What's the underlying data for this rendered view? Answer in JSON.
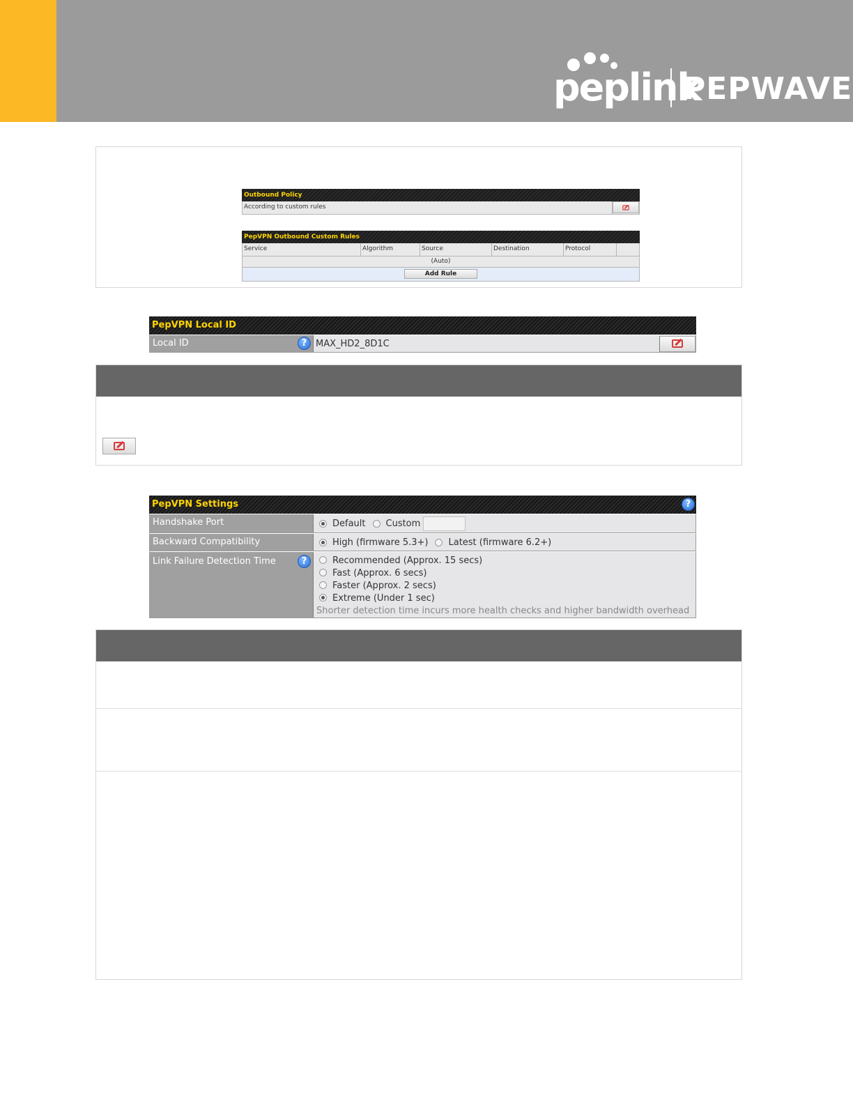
{
  "logo": {
    "primary": "peplink",
    "secondary": "PEPWAVE"
  },
  "outbound_policy": {
    "title": "Outbound Policy",
    "value": "According to custom rules"
  },
  "custom_rules": {
    "title": "PepVPN Outbound Custom Rules",
    "columns": [
      "Service",
      "Algorithm",
      "Source",
      "Destination",
      "Protocol",
      ""
    ],
    "auto_row": "(Auto)",
    "add_rule_label": "Add Rule"
  },
  "local_id": {
    "title": "PepVPN Local ID",
    "label": "Local ID",
    "value": "MAX_HD2_8D1C"
  },
  "settings": {
    "title": "PepVPN Settings",
    "handshake_port": {
      "label": "Handshake Port",
      "options": [
        "Default",
        "Custom"
      ],
      "selected": "Default",
      "custom_value": ""
    },
    "backward_compat": {
      "label": "Backward Compatibility",
      "options": [
        "High (firmware 5.3+)",
        "Latest (firmware 6.2+)"
      ],
      "selected": "High (firmware 5.3+)"
    },
    "link_failure": {
      "label": "Link Failure Detection Time",
      "options": [
        "Recommended (Approx. 15 secs)",
        "Fast (Approx. 6 secs)",
        "Faster (Approx. 2 secs)",
        "Extreme (Under 1 sec)"
      ],
      "selected": "Extreme (Under 1 sec)",
      "note": "Shorter detection time incurs more health checks and higher bandwidth overhead"
    }
  },
  "colors": {
    "accent": "#fdb826",
    "banner": "#9b9b9b",
    "table_header_text": "#ffd400",
    "section_band": "#666666"
  }
}
